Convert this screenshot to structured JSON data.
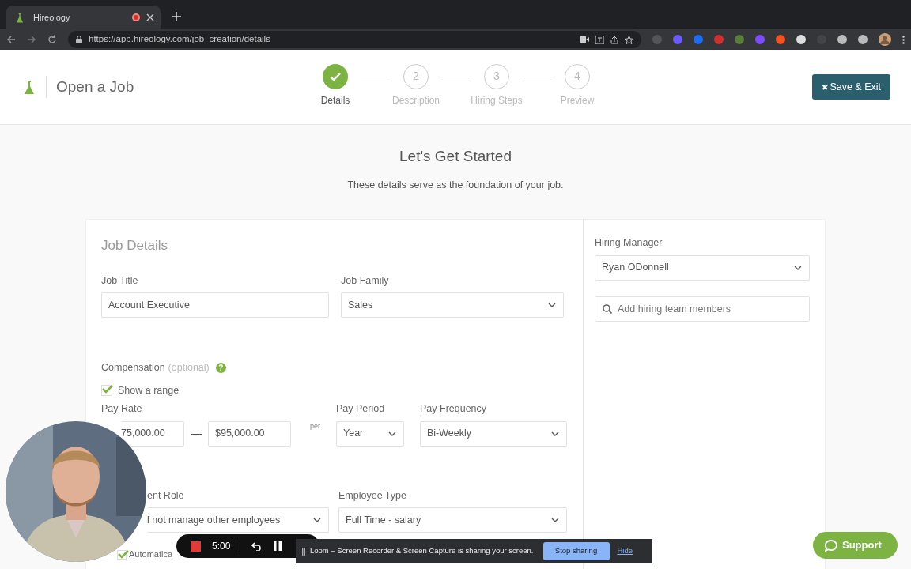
{
  "browser": {
    "tab_title": "Hireology",
    "url": "https://app.hireology.com/job_creation/details"
  },
  "header": {
    "title": "Open a Job",
    "save_button": "Save & Exit",
    "save_icon": "✖"
  },
  "steps": [
    {
      "label": "Details",
      "done": true
    },
    {
      "number": "2",
      "label": "Description",
      "done": false
    },
    {
      "number": "3",
      "label": "Hiring Steps",
      "done": false
    },
    {
      "number": "4",
      "label": "Preview",
      "done": false
    }
  ],
  "intro": {
    "title": "Let's Get Started",
    "subtitle": "These details serve as the foundation of your job."
  },
  "job_details": {
    "heading": "Job Details",
    "job_title": {
      "label": "Job Title",
      "value": "Account Executive"
    },
    "job_family": {
      "label": "Job Family",
      "value": "Sales"
    },
    "compensation": {
      "label": "Compensation",
      "optional": "(optional)",
      "help": "?"
    },
    "show_range": {
      "label": "Show a range",
      "checked": true
    },
    "pay_rate": {
      "label": "Pay Rate",
      "min": "75,000.00",
      "dash": "—",
      "max": "$95,000.00",
      "per": "per"
    },
    "pay_period": {
      "label": "Pay Period",
      "value": "Year"
    },
    "pay_frequency": {
      "label": "Pay Frequency",
      "value": "Bi-Weekly"
    },
    "management_role": {
      "label": "ent Role",
      "value": "l not manage other employees"
    },
    "employee_type": {
      "label": "Employee Type",
      "value": "Full Time - salary"
    },
    "auto_post": {
      "label": "Automatica",
      "checked": true
    }
  },
  "hiring": {
    "manager_label": "Hiring Manager",
    "manager": "Ryan ODonnell",
    "team_placeholder": "Add hiring team members"
  },
  "recorder": {
    "time": "5:00"
  },
  "share_banner": {
    "message": "Loom – Screen Recorder & Screen Capture is sharing your screen.",
    "stop": "Stop sharing",
    "hide": "Hide"
  },
  "support": {
    "label": "Support"
  }
}
